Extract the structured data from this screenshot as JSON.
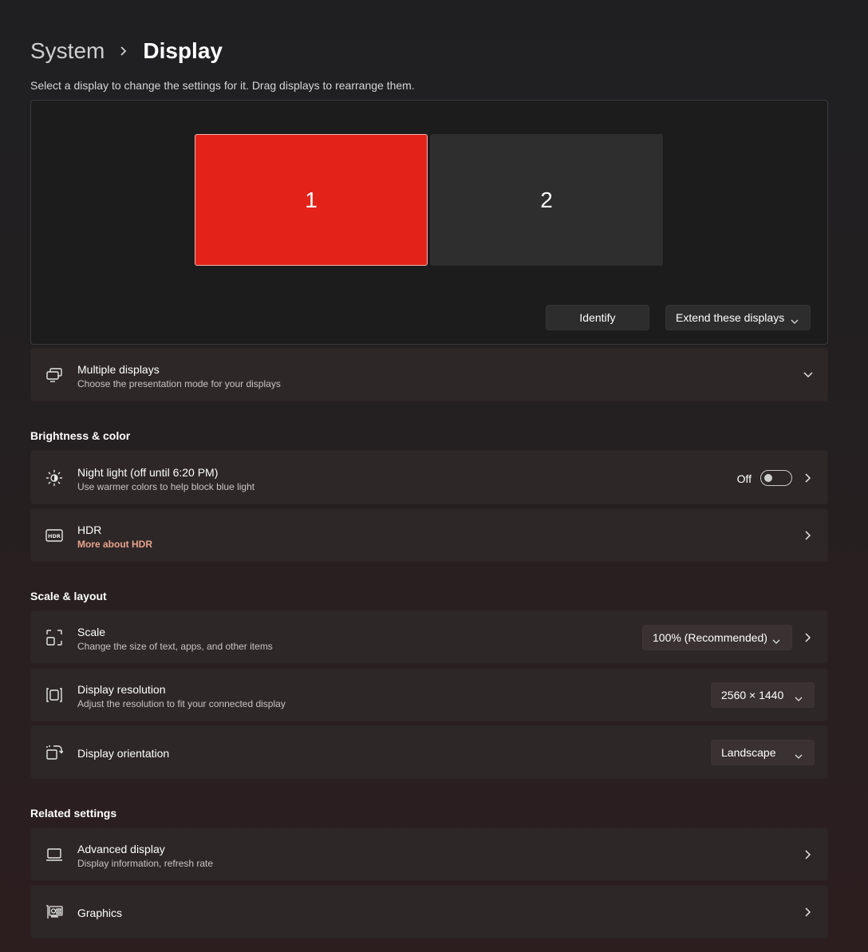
{
  "breadcrumb": {
    "parent": "System",
    "current": "Display"
  },
  "subtitle": "Select a display to change the settings for it. Drag displays to rearrange them.",
  "arrangement": {
    "monitors": [
      {
        "label": "1",
        "selected": true,
        "color": "#e3231a"
      },
      {
        "label": "2",
        "selected": false,
        "color": "#2e2e2e"
      }
    ],
    "identify_label": "Identify",
    "mode_value": "Extend these displays"
  },
  "multiple_displays": {
    "title": "Multiple displays",
    "desc": "Choose the presentation mode for your displays",
    "icon": "multiple-displays-icon"
  },
  "brightness_section": {
    "title": "Brightness & color",
    "night_light": {
      "title": "Night light (off until 6:20 PM)",
      "desc": "Use warmer colors to help block blue light",
      "toggle_label": "Off",
      "on": false,
      "icon": "brightness-sun-icon"
    },
    "hdr": {
      "title": "HDR",
      "link": "More about HDR",
      "icon": "hdr-icon"
    }
  },
  "scale_section": {
    "title": "Scale & layout",
    "scale": {
      "title": "Scale",
      "desc": "Change the size of text, apps, and other items",
      "value": "100% (Recommended)",
      "icon": "scale-icon"
    },
    "resolution": {
      "title": "Display resolution",
      "desc": "Adjust the resolution to fit your connected display",
      "value": "2560 × 1440",
      "icon": "resolution-icon"
    },
    "orientation": {
      "title": "Display orientation",
      "value": "Landscape",
      "icon": "orientation-icon"
    }
  },
  "related_section": {
    "title": "Related settings",
    "advanced": {
      "title": "Advanced display",
      "desc": "Display information, refresh rate",
      "icon": "laptop-icon"
    },
    "graphics": {
      "title": "Graphics",
      "icon": "graphics-card-icon"
    }
  },
  "colors": {
    "accent_link": "#e8a38d",
    "selected_monitor": "#e3231a"
  }
}
